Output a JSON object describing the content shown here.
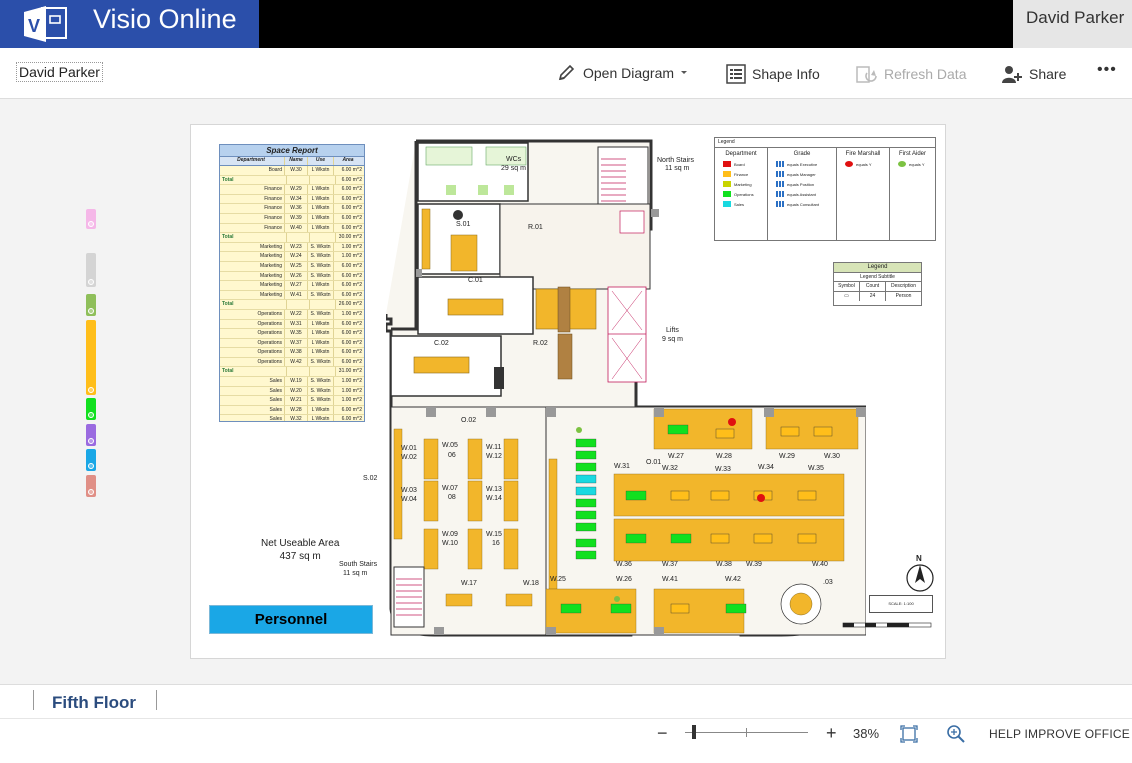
{
  "app": {
    "title": "Visio Online",
    "user": "David Parker",
    "brand_color": "#2b4faa"
  },
  "commandbar": {
    "document_owner": "David Parker",
    "open_diagram": "Open Diagram",
    "shape_info": "Shape Info",
    "refresh_data": "Refresh Data",
    "share": "Share",
    "more": "•••"
  },
  "layers": [
    {
      "color": "#f5b7e8"
    },
    {
      "color": "#d4d4d4"
    },
    {
      "color": "#8fbf5a"
    },
    {
      "color": "#ffbe1a"
    },
    {
      "color": "#11e01f"
    },
    {
      "color": "#9a6ae0"
    },
    {
      "color": "#1aa7e6"
    },
    {
      "color": "#e08f86"
    }
  ],
  "space_report": {
    "title": "Space Report",
    "headers": [
      "Department",
      "Name",
      "Use",
      "Area"
    ],
    "rows": [
      [
        "Board",
        "W.30",
        "L Wkstn",
        "6.00 m^2"
      ],
      [
        "Total",
        "",
        "",
        "6.00 m^2"
      ],
      [
        "Finance",
        "W.29",
        "L Wkstn",
        "6.00 m^2"
      ],
      [
        "Finance",
        "W.34",
        "L Wkstn",
        "6.00 m^2"
      ],
      [
        "Finance",
        "W.36",
        "L Wkstn",
        "6.00 m^2"
      ],
      [
        "Finance",
        "W.39",
        "L Wkstn",
        "6.00 m^2"
      ],
      [
        "Finance",
        "W.40",
        "L Wkstn",
        "6.00 m^2"
      ],
      [
        "Total",
        "",
        "",
        "30.00 m^2"
      ],
      [
        "Marketing",
        "W.23",
        "S. Wkstn",
        "1.00 m^2"
      ],
      [
        "Marketing",
        "W.24",
        "S. Wkstn",
        "1.00 m^2"
      ],
      [
        "Marketing",
        "W.25",
        "S. Wkstn",
        "6.00 m^2"
      ],
      [
        "Marketing",
        "W.26",
        "S. Wkstn",
        "6.00 m^2"
      ],
      [
        "Marketing",
        "W.27",
        "L Wkstn",
        "6.00 m^2"
      ],
      [
        "Marketing",
        "W.41",
        "S. Wkstn",
        "6.00 m^2"
      ],
      [
        "Total",
        "",
        "",
        "26.00 m^2"
      ],
      [
        "Operations",
        "W.22",
        "S. Wkstn",
        "1.00 m^2"
      ],
      [
        "Operations",
        "W.31",
        "L Wkstn",
        "6.00 m^2"
      ],
      [
        "Operations",
        "W.35",
        "L Wkstn",
        "6.00 m^2"
      ],
      [
        "Operations",
        "W.37",
        "L Wkstn",
        "6.00 m^2"
      ],
      [
        "Operations",
        "W.38",
        "L Wkstn",
        "6.00 m^2"
      ],
      [
        "Operations",
        "W.42",
        "S. Wkstn",
        "6.00 m^2"
      ],
      [
        "Total",
        "",
        "",
        "31.00 m^2"
      ],
      [
        "Sales",
        "W.19",
        "S. Wkstn",
        "1.00 m^2"
      ],
      [
        "Sales",
        "W.20",
        "S. Wkstn",
        "1.00 m^2"
      ],
      [
        "Sales",
        "W.21",
        "S. Wkstn",
        "1.00 m^2"
      ],
      [
        "Sales",
        "W.28",
        "L Wkstn",
        "6.00 m^2"
      ],
      [
        "Sales",
        "W.32",
        "L Wkstn",
        "6.00 m^2"
      ],
      [
        "Sales",
        "W.33",
        "L Wkstn",
        "6.00 m^2"
      ],
      [
        "Total",
        "",
        "",
        "21.00 m^2"
      ]
    ]
  },
  "plan_labels": {
    "wcs": "WCs",
    "wcs_area": "29 sq m",
    "north_stairs": "North Stairs",
    "north_stairs_area": "11 sq m",
    "s01": "S.01",
    "r01": "R.01",
    "c01": "C.01",
    "c02": "C.02",
    "r02": "R.02",
    "lifts": "Lifts",
    "lifts_area": "9 sq m",
    "o02": "O.02",
    "o01": "O.01",
    "s02": "S.02",
    "south_stairs": "South Stairs",
    "south_stairs_area": "11 sq m",
    "w01": "W.01",
    "w02": "W.02",
    "w03": "W.03",
    "w04": "W.04",
    "w05": "W.05",
    "w06": "06",
    "w07": "W.07",
    "w08": "08",
    "w09": "W.09",
    "w10": "W.10",
    "w11": "W.11",
    "w12": "W.12",
    "w13": "W.13",
    "w14": "W.14",
    "w15": "W.15",
    "w16": "16",
    "w17": "W.17",
    "w18": "W.18",
    "w25": "W.25",
    "w26": "W.26",
    "w27": "W.27",
    "w28": "W.28",
    "w29": "W.29",
    "w30": "W.30",
    "w31": "W.31",
    "w32": "W.32",
    "w33": "W.33",
    "w34": "W.34",
    "w35": "W.35",
    "w36": "W.36",
    "w37": "W.37",
    "w38": "W.38",
    "w39": "W.39",
    "w40": "W.40",
    "w41": "W.41",
    "w42": "W.42",
    "w03b": ".03"
  },
  "net_area": {
    "label": "Net Useable Area",
    "value": "437 sq m"
  },
  "personnel_label": "Personnel",
  "legend": {
    "title": "Legend",
    "columns": [
      "Department",
      "Grade",
      "Fire Marshall",
      "First Aider"
    ],
    "departments": [
      {
        "name": "Board",
        "color": "#e01010"
      },
      {
        "name": "Finance",
        "color": "#ffbe1a"
      },
      {
        "name": "Marketing",
        "color": "#c8d400"
      },
      {
        "name": "Operations",
        "color": "#11e01f"
      },
      {
        "name": "Sales",
        "color": "#19d9e0"
      }
    ],
    "grades": [
      "equals Executive",
      "equals Manager",
      "equals Position",
      "equals Assistant",
      "equals Consultant"
    ],
    "fire_marshall": "equals Y",
    "first_aider": "equals Y",
    "fire_color": "#e01010",
    "aider_color": "#7cc242"
  },
  "legend2": {
    "title": "Legend",
    "subtitle": "Legend Subtitle",
    "headers": [
      "Symbol",
      "Count",
      "Description"
    ],
    "count": "24",
    "description": "Person"
  },
  "scale": {
    "label": "SCALE: 1:100"
  },
  "north_label": "N",
  "tabs": [
    {
      "label": "Fifth Floor"
    }
  ],
  "status": {
    "zoom_minus": "−",
    "zoom_plus": "+",
    "zoom_level": "38%",
    "zoom_fraction": 0.07,
    "help": "HELP IMPROVE OFFICE"
  }
}
